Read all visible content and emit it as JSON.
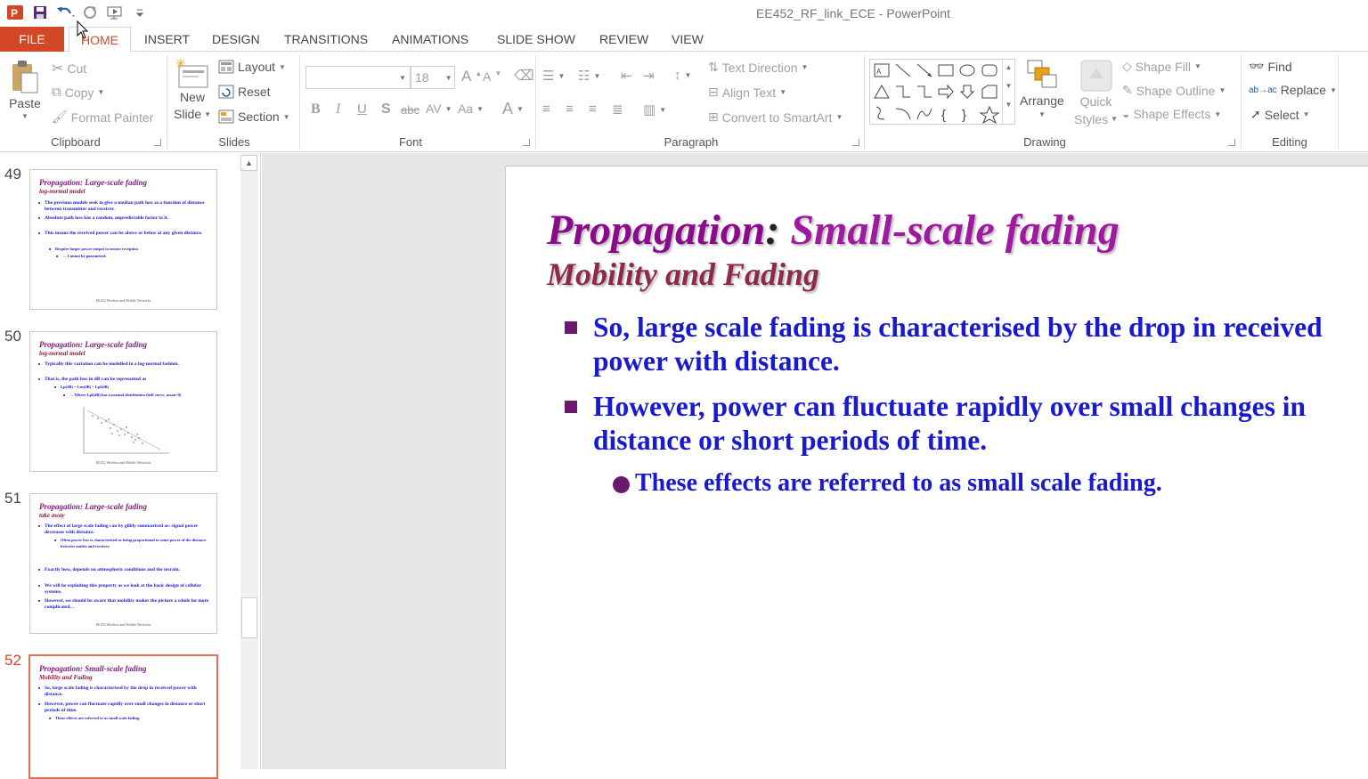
{
  "window": {
    "title": "EE452_RF_link_ECE - PowerPoint"
  },
  "tabs": [
    "FILE",
    "HOME",
    "INSERT",
    "DESIGN",
    "TRANSITIONS",
    "ANIMATIONS",
    "SLIDE SHOW",
    "REVIEW",
    "VIEW"
  ],
  "ribbon": {
    "clipboard": {
      "paste": "Paste",
      "cut": "Cut",
      "copy": "Copy",
      "format_painter": "Format Painter",
      "label": "Clipboard"
    },
    "slides": {
      "new_slide_1": "New",
      "new_slide_2": "Slide",
      "layout": "Layout",
      "reset": "Reset",
      "section": "Section",
      "label": "Slides"
    },
    "font": {
      "size": "18",
      "bold": "B",
      "italic": "I",
      "underline": "U",
      "shadow": "S",
      "strike": "abc",
      "spacing": "AV",
      "case": "Aa",
      "color": "A",
      "grow": "A",
      "shrink": "A",
      "label": "Font"
    },
    "paragraph": {
      "text_direction": "Text Direction",
      "align_text": "Align Text",
      "convert_smartart": "Convert to SmartArt",
      "label": "Paragraph"
    },
    "drawing": {
      "arrange": "Arrange",
      "quick_styles_1": "Quick",
      "quick_styles_2": "Styles",
      "shape_fill": "Shape Fill",
      "shape_outline": "Shape Outline",
      "shape_effects": "Shape Effects",
      "label": "Drawing"
    },
    "editing": {
      "find": "Find",
      "replace": "Replace",
      "select": "Select",
      "label": "Editing"
    }
  },
  "thumbnails": [
    {
      "num": "49",
      "title": "Propagation: Large-scale fading",
      "sub": "log-normal model",
      "bullets": [
        "The previous models seek to give a median path loss as a function of distance between transmitter and receiver.",
        "Absolute path loss has a random, unpredictable factor to it.",
        "This means the received power can be above or below at any given distance."
      ],
      "extra": [
        "Require larger power output to ensure reception",
        "→ Cannot be guaranteed."
      ],
      "footer": "EE452 Wireless and Mobile Networks"
    },
    {
      "num": "50",
      "title": "Propagation: Large-scale fading",
      "sub": "log-normal model",
      "bullets": [
        "Typically this variation can be modelled in a log-normal fashion.",
        "That is, the path loss in dB can be represented as"
      ],
      "extra": [
        "Lp(dB) = Lm(dB) + Lpl(dB)",
        "→ Where Lpl(dB) has a normal distribution (bell curve, mean=0)"
      ],
      "footer": "EE452 Wireless and Mobile Networks"
    },
    {
      "num": "51",
      "title": "Propagation: Large-scale fading",
      "sub": "take away",
      "bullets": [
        "The effect of large scale fading can by glibly summarised as: signal power decreases with distance.",
        "Exactly how, depends on atmospheric conditions and the terrain.",
        "We will be exploiting this property as we look at the basic design of cellular systems.",
        "However, we should be aware that mobility makes the picture a whole lot more complicated…"
      ],
      "extra": [
        "Often power loss is characterised as being proportional to some power of the distance between sender and receiver."
      ],
      "footer": "EE452 Wireless and Mobile Networks"
    },
    {
      "num": "52",
      "title": "Propagation: Small-scale fading",
      "sub": "Mobility and Fading",
      "bullets": [
        "So, large scale fading is characterised by the drop in received power with distance.",
        "However, power can fluctuate rapidly over small changes in distance or short periods of time."
      ],
      "extra": [
        "These effects are referred to as small scale fading."
      ],
      "footer": ""
    }
  ],
  "slide": {
    "title_a": "Propagation",
    "title_colon": ":",
    "title_b": " Small-scale fading",
    "subtitle": "Mobility and Fading",
    "bullet_1": "So, large scale fading is characterised by the drop in received power with distance.",
    "bullet_2": "However, power can fluctuate rapidly over small changes in distance or short periods of time.",
    "sub_bullet": "These effects are referred to as small scale fading."
  },
  "colors": {
    "accent": "#d24726",
    "title": "#8b0a8b",
    "body": "#1a1acd"
  }
}
